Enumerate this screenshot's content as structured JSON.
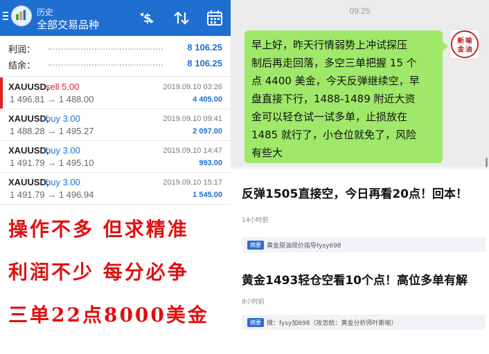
{
  "colors": {
    "accent_blue": "#1f6fd1",
    "sell_red": "#d62020",
    "slogan_red": "#e01010",
    "bubble_green": "#9fe86a"
  },
  "left": {
    "header": {
      "title": "历史",
      "subtitle": "全部交易品种",
      "icons": [
        "menu-icon",
        "dollar-swap-icon",
        "sort-icon",
        "calendar-icon"
      ]
    },
    "summary": [
      {
        "label": "利润：",
        "value": "8 106.25"
      },
      {
        "label": "结余：",
        "value": "8 106.25"
      }
    ],
    "trades": [
      {
        "symbol": "XAUUSD,",
        "side": "sell 5.00",
        "side_type": "sell",
        "prices": "1 496.81 → 1 488.00",
        "time": "2019.09.10 03:26",
        "profit": "4 405.00"
      },
      {
        "symbol": "XAUUSD,",
        "side": "buy 3.00",
        "side_type": "buy",
        "prices": "1 488.28 → 1 495.27",
        "time": "2019.09.10 09:41",
        "profit": "2 097.00"
      },
      {
        "symbol": "XAUUSD,",
        "side": "buy 3.00",
        "side_type": "buy",
        "prices": "1 491.79 → 1 495.10",
        "time": "2019.09.10 14:47",
        "profit": "993.00"
      },
      {
        "symbol": "XAUUSD,",
        "side": "buy 3.00",
        "side_type": "buy",
        "prices": "1 491.79 → 1 496.94",
        "time": "2019.09.10 15:17",
        "profit": "1 545.00"
      }
    ],
    "slogans": [
      "操作不多 但求精准",
      "利润不少 每分必争",
      "三单22点8000美金"
    ]
  },
  "right": {
    "chat": {
      "time": "09:25",
      "message_lines": [
        "早上好，昨天行情弱势上冲试探压",
        "制后再走回落，多空三单把握 15 个",
        "点 4400 美金，今天反弹继续空，早",
        "盘直接下行，1488-1489 附近大资",
        "金可以轻仓试一试多单，止损放在",
        "1485 就行了，小仓位就免了，风险",
        "有些大"
      ],
      "avatar_text": [
        "新",
        "喻",
        "金",
        "油"
      ]
    },
    "articles": [
      {
        "title": "反弹1505直接空，今日再看20点！回本！",
        "meta": "14小时前",
        "tag": "摘要",
        "summary": "黄金原油现价指导fysy698"
      },
      {
        "title": "黄金1493轻仓空看10个点！高位多单有解",
        "meta": "8小时前",
        "tag": "摘要",
        "summary": "微：fysy加698（攻忠航：黄金分析师叶斯喻）"
      }
    ]
  }
}
